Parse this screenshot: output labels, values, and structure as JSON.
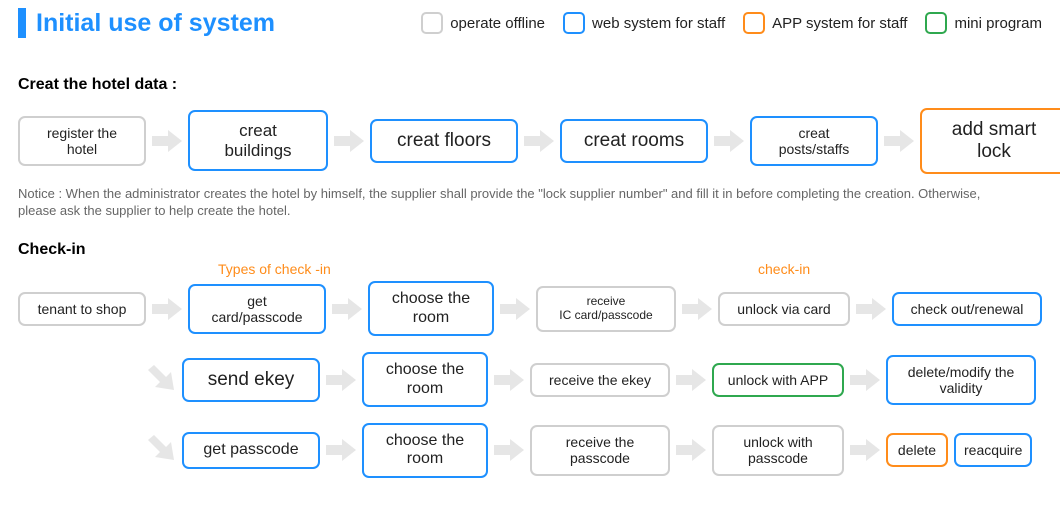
{
  "title": "Initial use of system",
  "legend": {
    "offline": "operate offline",
    "web": "web system for staff",
    "app": "APP system for staff",
    "mini": "mini program"
  },
  "section1": {
    "heading": "Creat the hotel data :",
    "steps": {
      "register": "register the\nhotel",
      "buildings": "creat buildings",
      "floors": "creat floors",
      "rooms": "creat rooms",
      "posts": "creat\nposts/staffs",
      "addlock": "add smart lock"
    },
    "notice": "Notice :  When the administrator creates the hotel by himself, the supplier shall provide the \"lock supplier number\" and fill it in before completing the creation. Otherwise, please ask the supplier to help create the hotel."
  },
  "section2": {
    "heading": "Check-in",
    "label_types": "Types of check -in",
    "label_checkin": "check-in",
    "tenant": "tenant to shop",
    "row1": {
      "a": "get\ncard/passcode",
      "b": "choose the\nroom",
      "c": "receive\nIC card/passcode",
      "d": "unlock via card",
      "e": "check out/renewal"
    },
    "row2": {
      "a": "send ekey",
      "b": "choose the\nroom",
      "c": "receive the ekey",
      "d": "unlock with APP",
      "e": "delete/modify the\nvalidity"
    },
    "row3": {
      "a": "get passcode",
      "b": "choose the\nroom",
      "c": "receive the\npasscode",
      "d": "unlock with\npasscode",
      "e1": "delete",
      "e2": "reacquire"
    }
  }
}
